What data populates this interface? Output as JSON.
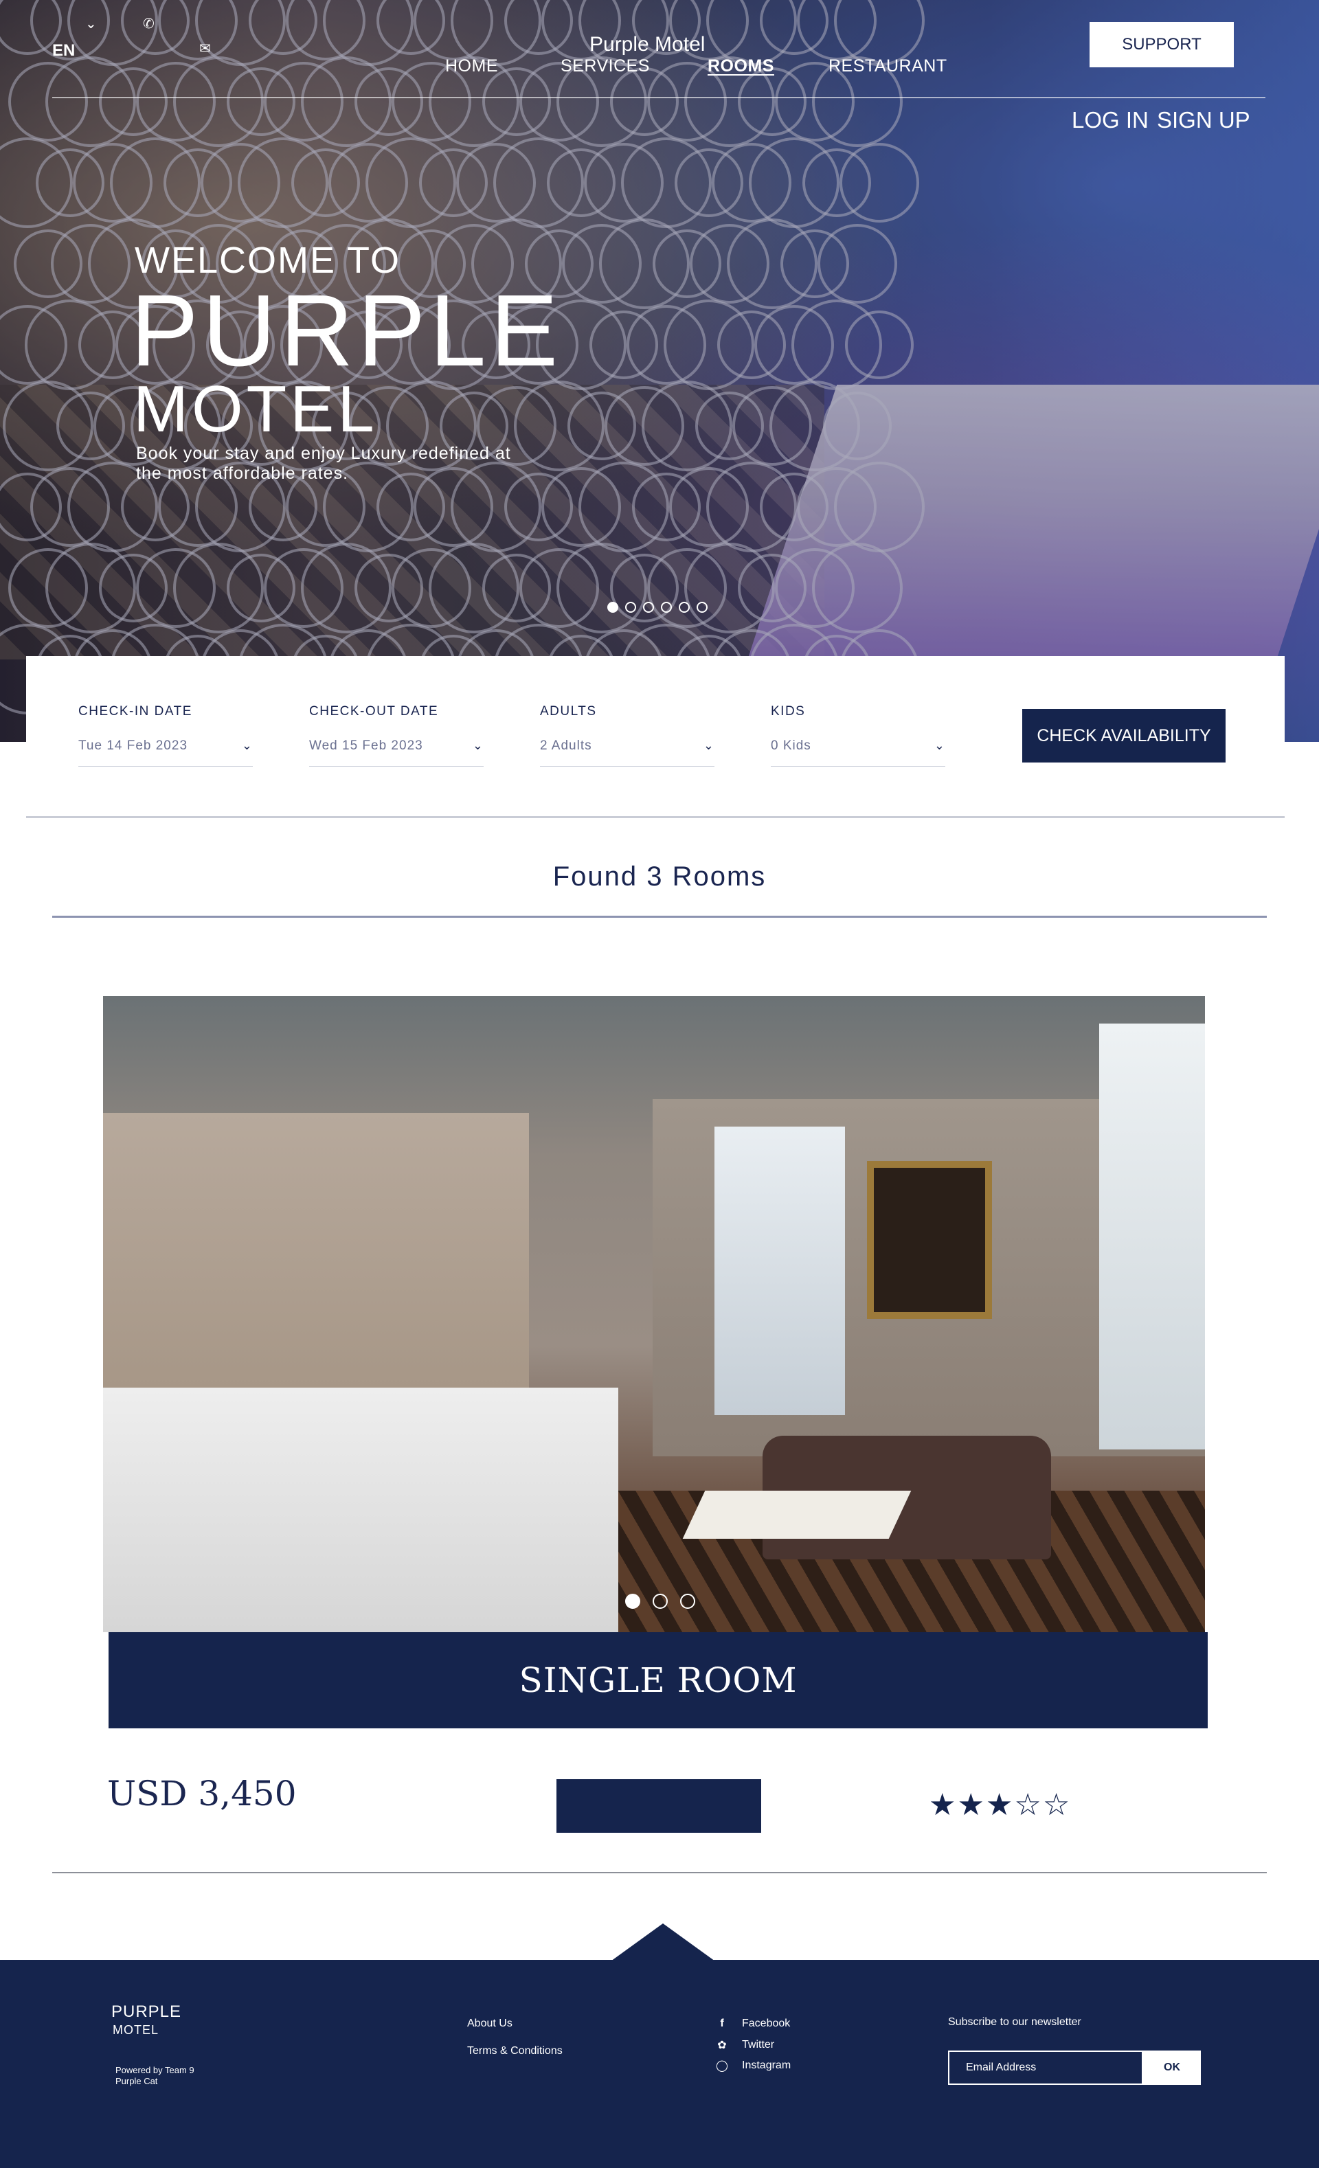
{
  "header": {
    "language": "EN",
    "site_title": "Purple Motel",
    "nav": [
      "HOME",
      "SERVICES",
      "ROOMS",
      "RESTAURANT"
    ],
    "active_nav": "ROOMS",
    "support_label": "SUPPORT",
    "login_label": "LOG IN",
    "signup_label": "SIGN UP",
    "icons": [
      "phone-icon",
      "mail-icon"
    ]
  },
  "hero": {
    "welcome": "WELCOME TO",
    "title_1": "PURPLE",
    "title_2": "MOTEL",
    "tagline": "Book your stay and enjoy Luxury redefined at the most affordable rates.",
    "slides": 6,
    "active_slide": 1
  },
  "booking": {
    "checkin_label": "CHECK-IN DATE",
    "checkin_value": "Tue 14 Feb 2023",
    "checkout_label": "CHECK-OUT DATE",
    "checkout_value": "Wed 15 Feb 2023",
    "adults_label": "ADULTS",
    "adults_value": "2 Adults",
    "kids_label": "KIDS",
    "kids_value": "0 Kids",
    "check_label": "CHECK AVAILABILITY"
  },
  "results": {
    "found_text": "Found 3 Rooms"
  },
  "room": {
    "name": "SINGLE ROOM",
    "price": "USD 3,450",
    "rating": 3,
    "max_rating": 5,
    "photos": 3,
    "active_photo": 1
  },
  "footer": {
    "brand_1": "PURPLE",
    "brand_2": "MOTEL",
    "powered_1": "Powered by Team 9",
    "powered_2": "Purple Cat",
    "links": [
      "About Us",
      "Terms & Conditions"
    ],
    "social": [
      {
        "label": "Facebook",
        "icon": "facebook-icon"
      },
      {
        "label": "Twitter",
        "icon": "twitter-icon"
      },
      {
        "label": "Instagram",
        "icon": "instagram-icon"
      }
    ],
    "subscribe_label": "Subscribe to our newsletter",
    "email_placeholder": "Email Address",
    "ok_label": "OK"
  },
  "colors": {
    "navy": "#15244d",
    "text": "#1a2550",
    "white": "#ffffff"
  }
}
